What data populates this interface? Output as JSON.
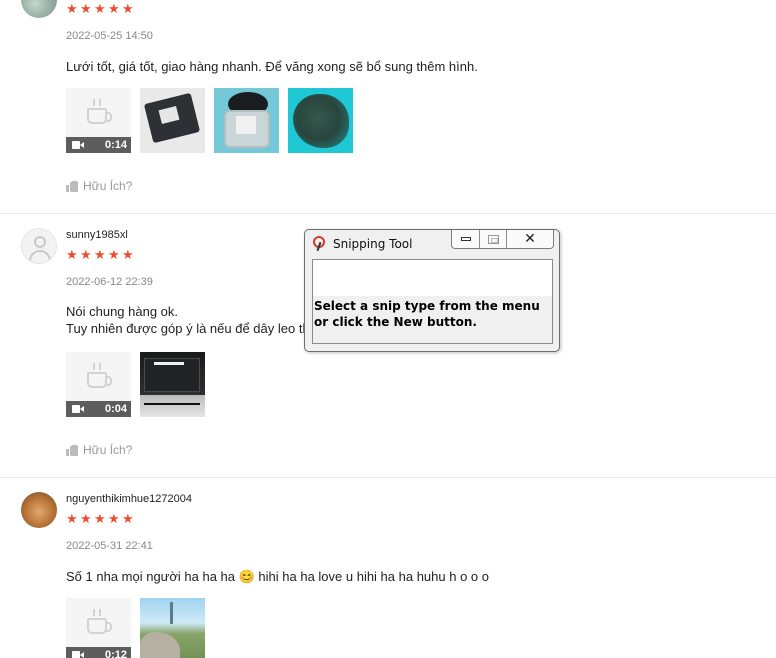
{
  "reviews": [
    {
      "username": "",
      "rating": 5,
      "timestamp": "2022-05-25 14:50",
      "comment_lines": [
        "Lưới tốt, giá tốt, giao hàng nhanh. Để văng xong sẽ bổ sung thêm hình."
      ],
      "video_duration": "0:14",
      "helpful_label": "Hữu Ích?"
    },
    {
      "username": "sunny1985xl",
      "rating": 5,
      "timestamp": "2022-06-12 22:39",
      "comment_lines": [
        "Nói chung hàng ok.",
        "Tuy nhiên được góp ý là nếu để dây leo thì"
      ],
      "video_duration": "0:04",
      "helpful_label": "Hữu Ích?"
    },
    {
      "username": "nguyenthikimhue1272004",
      "rating": 5,
      "timestamp": "2022-05-31 22:41",
      "comment_lines": [
        "Số 1 nha mọi người ha ha ha 😊 hihi ha ha love u hihi ha ha huhu h o o o"
      ],
      "video_duration": "0:12"
    }
  ],
  "snipping_tool": {
    "title": "Snipping Tool",
    "message": "Select a snip type from the menu or click the New button."
  },
  "colors": {
    "star": "#ee4d2d",
    "timestamp": "#888888",
    "helpful": "#999999"
  }
}
